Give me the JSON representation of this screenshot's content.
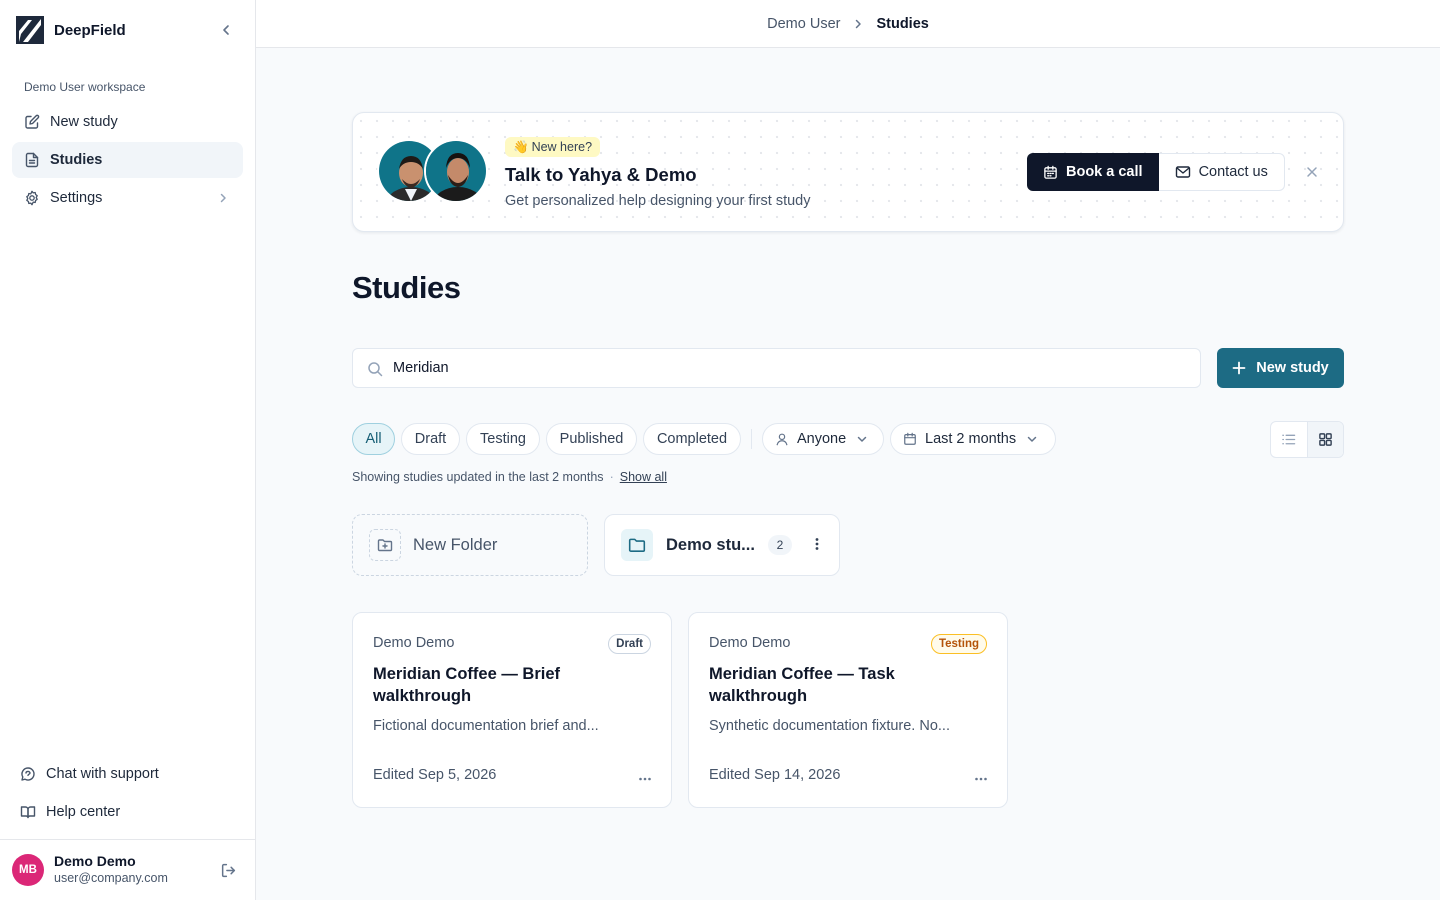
{
  "sidebar": {
    "brand": "DeepField",
    "workspace_label": "Demo User workspace",
    "nav": [
      {
        "label": "New study",
        "icon": "edit-icon"
      },
      {
        "label": "Studies",
        "icon": "document-icon"
      },
      {
        "label": "Settings",
        "icon": "gear-icon"
      }
    ],
    "active": "Studies",
    "bottom_links": [
      {
        "label": "Chat with support",
        "icon": "chat-icon"
      },
      {
        "label": "Help center",
        "icon": "book-icon"
      }
    ],
    "user": {
      "initials": "MB",
      "name": "Demo Demo",
      "email": "user@company.com",
      "avatar_color": "#db2777"
    }
  },
  "topbar": {
    "breadcrumb": [
      "Demo User",
      "Studies"
    ]
  },
  "banner": {
    "tag_emoji": "👋",
    "tag": "New here?",
    "title": "Talk to Yahya & Demo",
    "subtitle": "Get personalized help designing your first study",
    "book_label": "Book a call",
    "contact_label": "Contact us"
  },
  "main": {
    "title": "Studies",
    "search": {
      "value": "Meridian"
    },
    "new_study_label": "New study",
    "filters": [
      "All",
      "Draft",
      "Testing",
      "Published",
      "Completed"
    ],
    "active_filter": "All",
    "owner_filter": "Anyone",
    "date_filter": "Last 2 months",
    "showing_text": "Showing studies updated in the last 2 months",
    "show_all": "Show all",
    "view_mode": "grid"
  },
  "folders": {
    "new_label": "New Folder",
    "items": [
      {
        "name": "Demo stu...",
        "count": "2"
      }
    ]
  },
  "studies": [
    {
      "owner": "Demo Demo",
      "status": "Draft",
      "title": "Meridian Coffee — Brief walkthrough",
      "description": "Fictional documentation brief and...",
      "edited": "Edited Sep 5, 2026"
    },
    {
      "owner": "Demo Demo",
      "status": "Testing",
      "title": "Meridian Coffee — Task walkthrough",
      "description": "Synthetic documentation fixture. No...",
      "edited": "Edited Sep 14, 2026"
    }
  ],
  "colors": {
    "accent": "#1d6b84",
    "dark_button": "#0f172a",
    "testing_badge": "#b45309"
  }
}
